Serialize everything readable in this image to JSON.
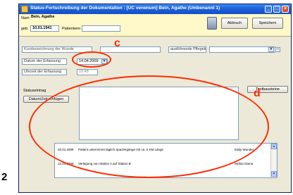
{
  "page_number": "2",
  "window": {
    "title": "Status-Fortschreibung der Dokumentation : [UC venenum]  Bein, Agathe (Umbenannt 1)",
    "controls": [
      "minimize-icon",
      "maximize-icon",
      "close-icon"
    ]
  },
  "header": {
    "name_label": "Name",
    "name_value": "Bein, Agathe",
    "geb_label": "geb.",
    "geb_value": "10.01.1941",
    "patient_label": "Patientenn",
    "abbruch_label": "Abbruch",
    "speichern_label": "Speichern"
  },
  "form": {
    "kurzbezeichnung_placeholder": "Kurzbezeichnung der Wunde",
    "pflegekraft_label": "ausführende Pflegekr.",
    "datum_label": "Datum der Erfassung",
    "datum_value": "14.04.2009",
    "uhrzeit_label": "Uhrzeit der Erfassung",
    "uhrzeit_value": "10:48",
    "statuseintrag_label": "Statuseintrag",
    "datum_zeit_button": "Datum/Zeit einfügen",
    "textbausteine_button": "Textbausteine"
  },
  "history": {
    "rows": [
      {
        "date": "20.01.2009",
        "text": "Patient unternimmt täglich Spaziergänge mit ca. 5 KM Länge",
        "user": "Eddy Wunder"
      },
      {
        "date": "12.01.2009",
        "text": "Verlegung von Station A auf Station B",
        "user": "Stefan Dama"
      }
    ]
  },
  "annotations": {
    "c_label": "c",
    "d_label": "d",
    "color": "#ff2a00"
  }
}
